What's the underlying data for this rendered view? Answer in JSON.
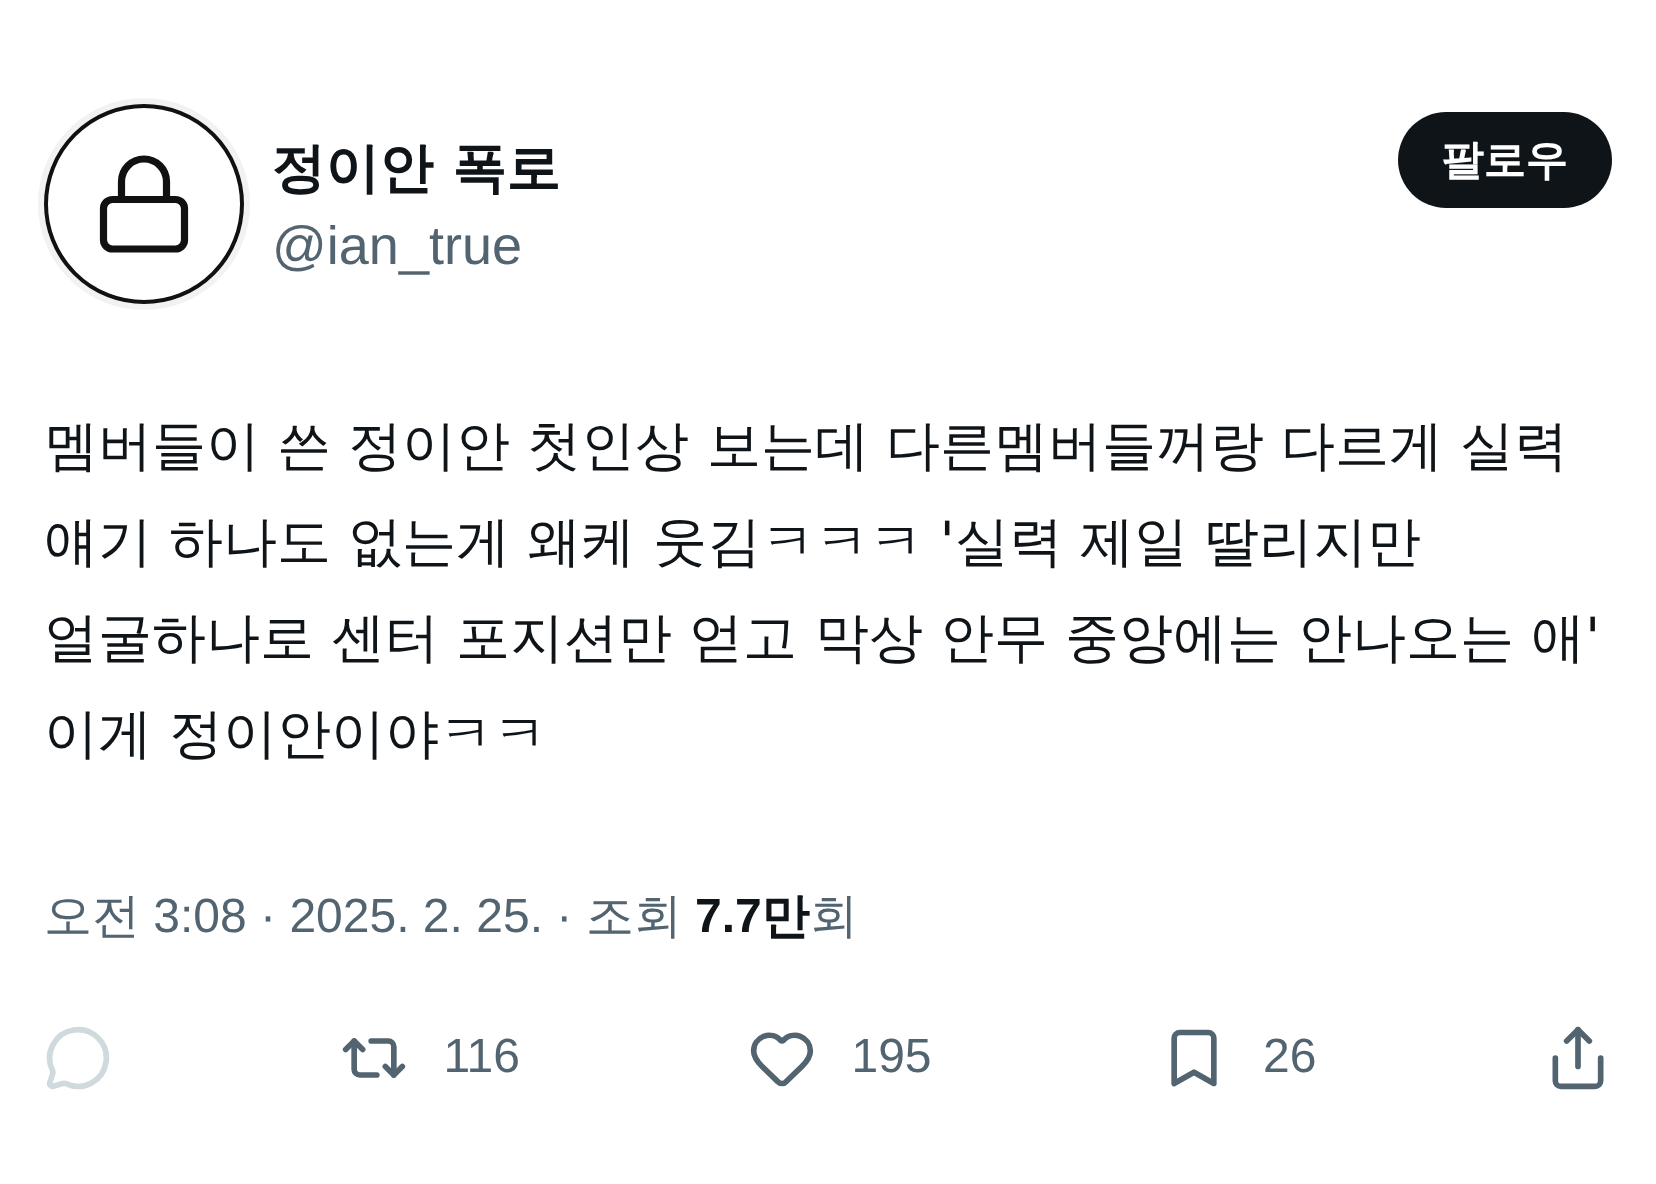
{
  "author": {
    "name": "정이안 폭로",
    "handle": "@ian_true"
  },
  "follow_button": {
    "label": "팔로우"
  },
  "body": "멤버들이 쓴 정이안 첫인상 보는데 다른멤버들꺼랑 다르게 실력 얘기 하나도 없는게 왜케 웃김ㅋㅋㅋ '실력 제일 딸리지만 얼굴하나로 센터 포지션만 얻고 막상 안무 중앙에는 안나오는 애' 이게 정이안이야ㅋㅋ",
  "meta": "오전 3:08 · 2025. 2. 25. · 조회 **7.7만**회",
  "actions": [
    {
      "kind": "reply",
      "disabled": true
    },
    {
      "kind": "repost",
      "count": "116",
      "disabled": false
    },
    {
      "kind": "like",
      "count": "195",
      "disabled": false
    },
    {
      "kind": "bookmark",
      "count": "26",
      "disabled": false
    },
    {
      "kind": "share",
      "disabled": false
    }
  ]
}
